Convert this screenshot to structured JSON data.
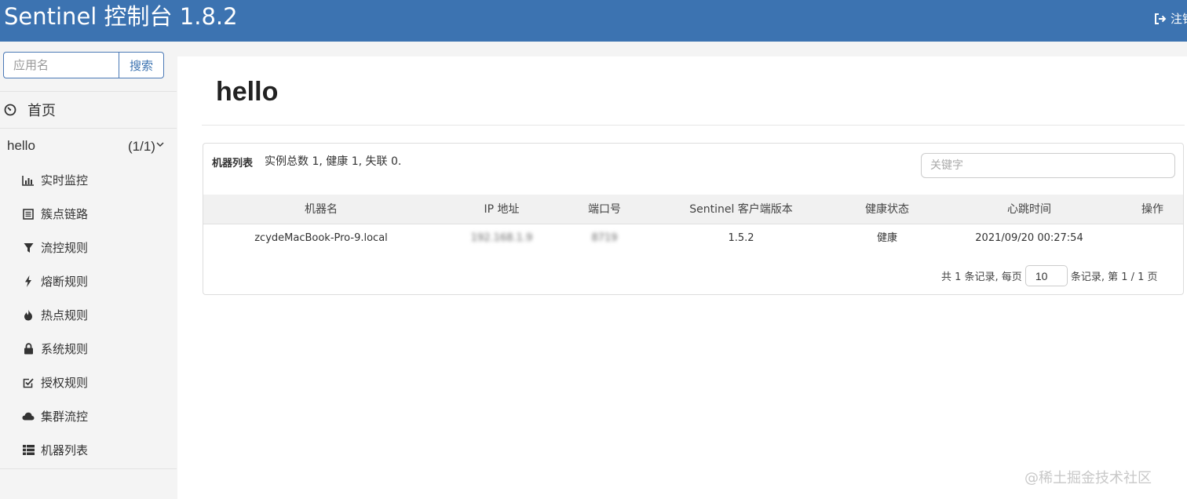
{
  "header": {
    "title": "Sentinel 控制台 1.8.2",
    "logout_label": "注销",
    "logout_icon": "sign-out-icon",
    "background_color": "#3c73b1"
  },
  "sidebar": {
    "search": {
      "placeholder": "应用名",
      "button_label": "搜索"
    },
    "home": {
      "label": "首页",
      "icon": "dashboard-icon"
    },
    "app": {
      "name": "hello",
      "count": "(1/1)",
      "icon": "chevron-down-icon"
    },
    "menu": [
      {
        "label": "实时监控",
        "icon": "bar-chart-icon"
      },
      {
        "label": "簇点链路",
        "icon": "list-alt-icon"
      },
      {
        "label": "流控规则",
        "icon": "filter-icon"
      },
      {
        "label": "熔断规则",
        "icon": "flash-icon"
      },
      {
        "label": "热点规则",
        "icon": "fire-icon"
      },
      {
        "label": "系统规则",
        "icon": "lock-icon"
      },
      {
        "label": "授权规则",
        "icon": "check-icon"
      },
      {
        "label": "集群流控",
        "icon": "cloud-icon"
      },
      {
        "label": "机器列表",
        "icon": "th-list-icon"
      }
    ]
  },
  "main": {
    "title": "hello",
    "panel": {
      "label": "机器列表",
      "summary": "实例总数 1, 健康 1, 失联 0.",
      "keyword_placeholder": "关键字"
    },
    "table": {
      "columns": [
        "机器名",
        "IP 地址",
        "端口号",
        "Sentinel 客户端版本",
        "健康状态",
        "心跳时间",
        "操作"
      ],
      "rows": [
        {
          "machine": "zcydeMacBook-Pro-9.local",
          "ip": "192.168.1.9",
          "port": "8719",
          "version": "1.5.2",
          "health": "健康",
          "heartbeat": "2021/09/20 00:27:54",
          "action": ""
        }
      ]
    },
    "pager": {
      "prefix": "共 1 条记录, 每页",
      "page_size": "10",
      "suffix": "条记录, 第 1 / 1 页"
    }
  },
  "watermark": "@稀土掘金技术社区"
}
